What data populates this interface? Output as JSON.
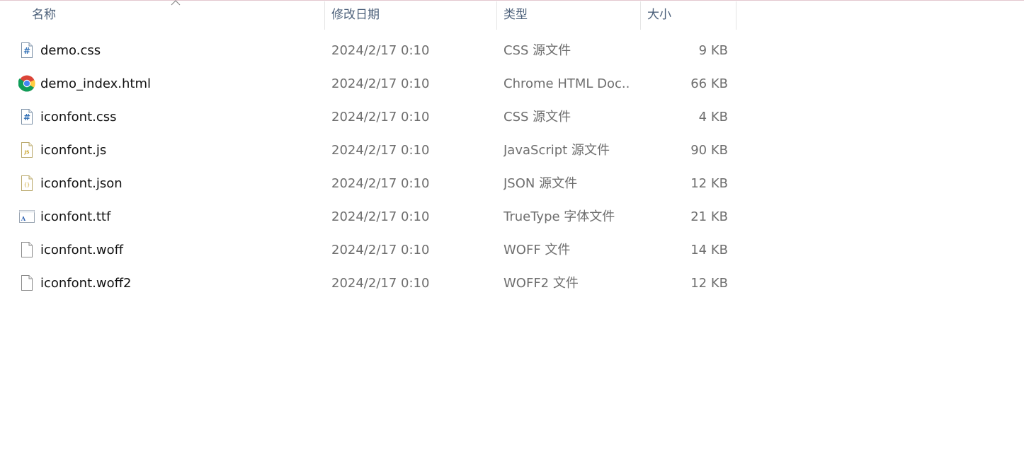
{
  "header": {
    "name_label": "名称",
    "date_label": "修改日期",
    "type_label": "类型",
    "size_label": "大小"
  },
  "files": [
    {
      "name": "demo.css",
      "date": "2024/2/17 0:10",
      "type": "CSS 源文件",
      "size": "9 KB",
      "icon": "css-file-icon"
    },
    {
      "name": "demo_index.html",
      "date": "2024/2/17 0:10",
      "type": "Chrome HTML Doc...",
      "size": "66 KB",
      "icon": "chrome-icon"
    },
    {
      "name": "iconfont.css",
      "date": "2024/2/17 0:10",
      "type": "CSS 源文件",
      "size": "4 KB",
      "icon": "css-file-icon"
    },
    {
      "name": "iconfont.js",
      "date": "2024/2/17 0:10",
      "type": "JavaScript 源文件",
      "size": "90 KB",
      "icon": "js-file-icon"
    },
    {
      "name": "iconfont.json",
      "date": "2024/2/17 0:10",
      "type": "JSON 源文件",
      "size": "12 KB",
      "icon": "json-file-icon"
    },
    {
      "name": "iconfont.ttf",
      "date": "2024/2/17 0:10",
      "type": "TrueType 字体文件",
      "size": "21 KB",
      "icon": "font-file-icon"
    },
    {
      "name": "iconfont.woff",
      "date": "2024/2/17 0:10",
      "type": "WOFF 文件",
      "size": "14 KB",
      "icon": "blank-file-icon"
    },
    {
      "name": "iconfont.woff2",
      "date": "2024/2/17 0:10",
      "type": "WOFF2 文件",
      "size": "12 KB",
      "icon": "blank-file-icon"
    }
  ]
}
